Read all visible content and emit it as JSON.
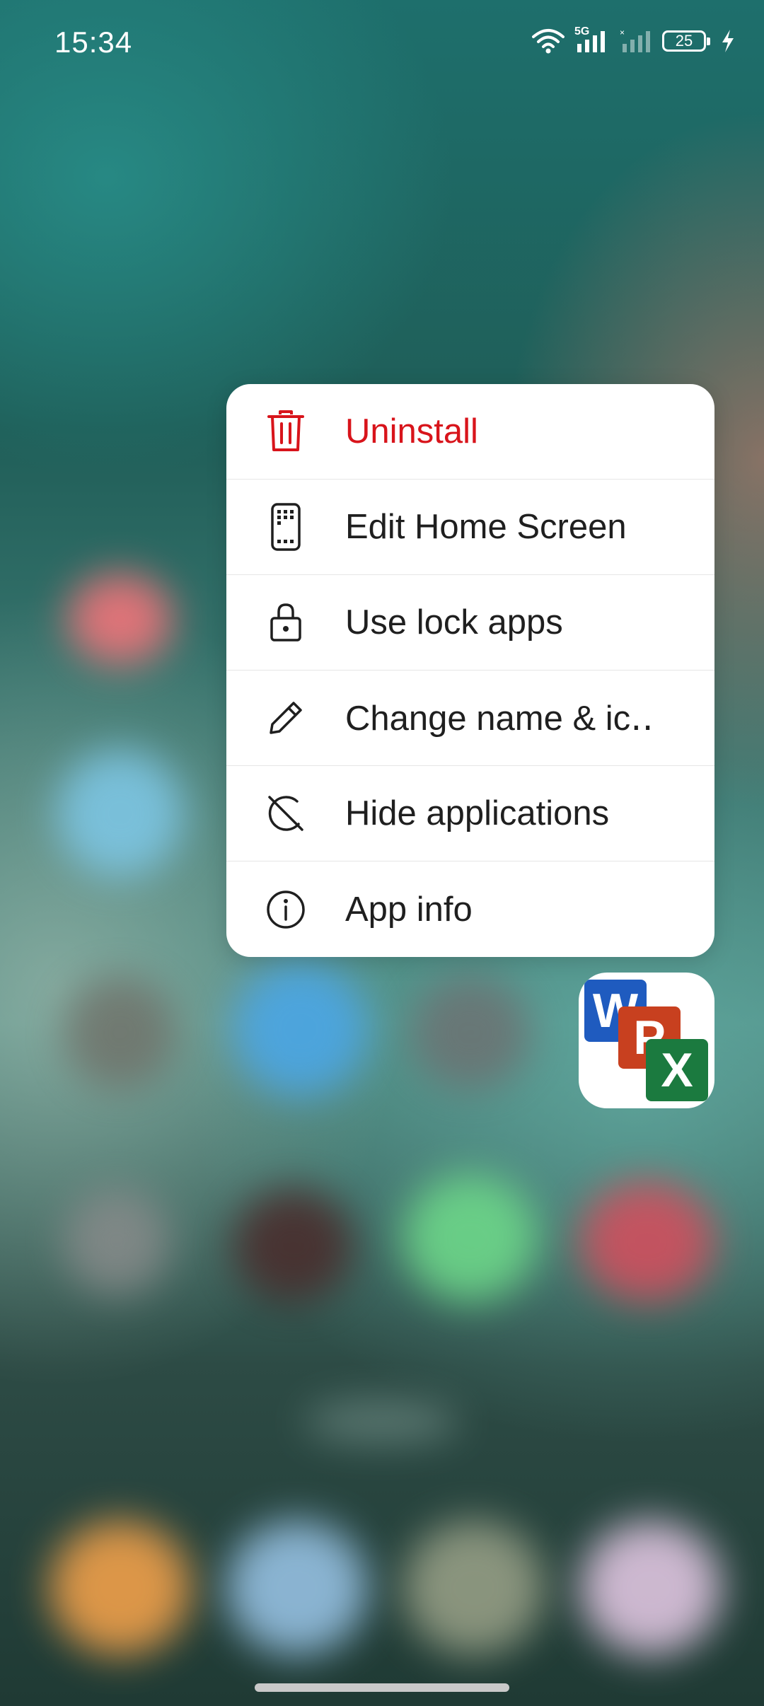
{
  "status_bar": {
    "time": "15:34",
    "network_label": "5G",
    "battery_level": "25",
    "icons": [
      "wifi-icon",
      "signal-5g-icon",
      "signal-no-service-icon",
      "battery-icon",
      "charging-bolt-icon"
    ]
  },
  "context_menu": {
    "items": [
      {
        "label": "Uninstall",
        "icon": "trash-icon",
        "color": "#d8141b"
      },
      {
        "label": "Edit Home Screen",
        "icon": "phone-grid-icon"
      },
      {
        "label": "Use lock apps",
        "icon": "lock-icon"
      },
      {
        "label": "Change name & ic‥",
        "icon": "pencil-icon"
      },
      {
        "label": "Hide applications",
        "icon": "hidden-icon"
      },
      {
        "label": "App info",
        "icon": "info-icon"
      }
    ]
  },
  "app_icon": {
    "icon": "office-apps-icon",
    "letters": [
      "W",
      "P",
      "X"
    ],
    "colors": {
      "word": "#1f5bbf",
      "powerpoint": "#c8401f",
      "excel": "#1b7a3f"
    }
  },
  "colors": {
    "danger": "#d8141b",
    "menu_text": "#1f1f1f",
    "menu_bg": "#ffffff"
  }
}
